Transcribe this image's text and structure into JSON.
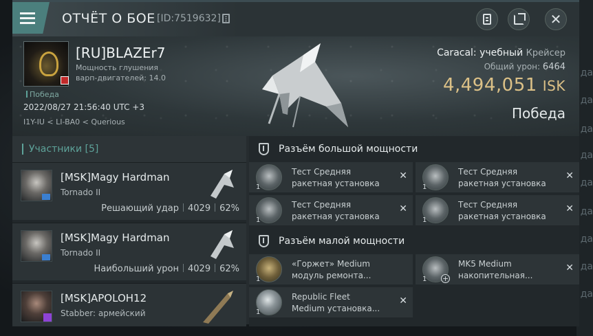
{
  "window": {
    "title": "ОТЧЁТ О БОЕ",
    "report_id": "[ID:7519632]"
  },
  "edge_labels": [
    "да",
    "да",
    "да",
    "да",
    "да",
    "да",
    "да",
    "да",
    "да"
  ],
  "victim": {
    "name": "[RU]BLAZEr7",
    "attr_line1": "Мощность глушения",
    "attr_line2": "варп-двигателей: 14.0",
    "status": "Победа",
    "datetime": "2022/08/27 21:56:40 UTC +3",
    "route": "I1Y-IU < LI-BA0 < Querious"
  },
  "ship": {
    "name": "Caracal: учебный",
    "class": "Крейсер",
    "damage_label": "Общий урон:",
    "damage_value": "6464",
    "isk_value": "4,494,051",
    "isk_unit": "ISK",
    "result": "Победа"
  },
  "participants": {
    "header": "Участники [5]",
    "rows": [
      {
        "name": "[MSK]Magy Hardman",
        "ship": "Tornado II",
        "label": "Решающий удар",
        "damage": "4029",
        "percent": "62%"
      },
      {
        "name": "[MSK]Magy Hardman",
        "ship": "Tornado II",
        "label": "Наибольший урон",
        "damage": "4029",
        "percent": "62%"
      },
      {
        "name": "[MSK]APOLOH12",
        "ship": "Stabber: армейский",
        "label": "",
        "damage": "",
        "percent": ""
      }
    ]
  },
  "slots": {
    "high": {
      "title": "Разъём большой мощности",
      "modules": [
        {
          "line1": "Тест Средняя",
          "line2": "ракетная установка",
          "qty": "1"
        },
        {
          "line1": "Тест Средняя",
          "line2": "ракетная установка",
          "qty": "1"
        },
        {
          "line1": "Тест Средняя",
          "line2": "ракетная установка",
          "qty": "1"
        },
        {
          "line1": "Тест Средняя",
          "line2": "ракетная установка",
          "qty": "1"
        }
      ]
    },
    "low": {
      "title": "Разъём малой мощности",
      "modules": [
        {
          "line1": "«Горжет» Medium",
          "line2": "модуль ремонта...",
          "qty": "1"
        },
        {
          "line1": "MK5 Medium",
          "line2": "накопительная...",
          "qty": "1"
        },
        {
          "line1": "Republic Fleet",
          "line2": "Medium установка...",
          "qty": "1"
        }
      ]
    }
  },
  "close_glyph": "✕",
  "plus_glyph": "+"
}
